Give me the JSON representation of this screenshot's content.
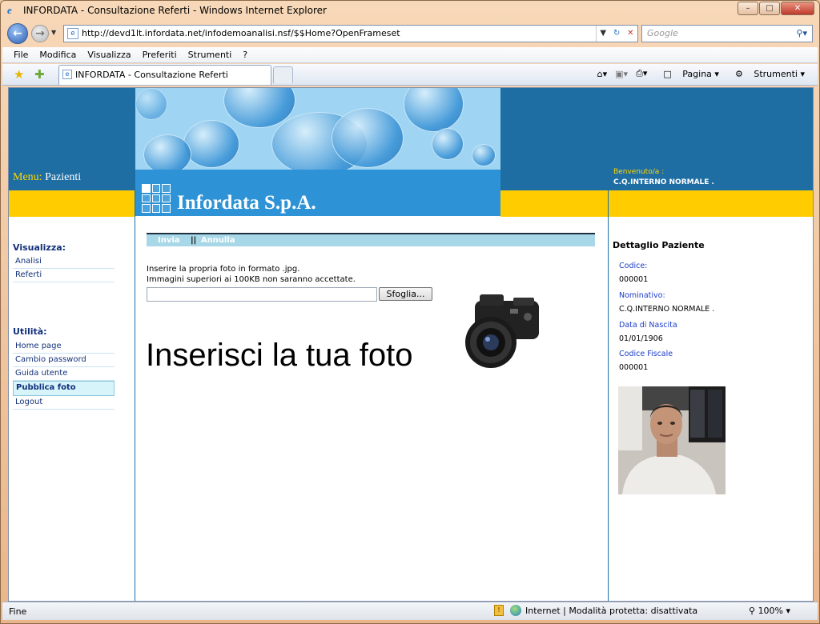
{
  "window": {
    "title": "INFORDATA - Consultazione Referti - Windows Internet Explorer"
  },
  "address": {
    "url": "http://devd1lt.infordata.net/infodemoanalisi.nsf/$$Home?OpenFrameset",
    "search_placeholder": "Google"
  },
  "menubar": [
    "File",
    "Modifica",
    "Visualizza",
    "Preferiti",
    "Strumenti",
    "?"
  ],
  "tab": {
    "label": "INFORDATA - Consultazione Referti"
  },
  "commandbar": {
    "page": "Pagina",
    "tools": "Strumenti"
  },
  "header": {
    "menu_label": "Menu:",
    "menu_value": "Pazienti",
    "logo": "Infordata S.p.A.",
    "welcome_label": "Benvenuto/a :",
    "welcome_user": "C.Q.INTERNO NORMALE ."
  },
  "sidebar": {
    "visualizza_title": "Visualizza:",
    "visualizza_items": [
      "Analisi",
      "Referti"
    ],
    "utilita_title": "Utilità:",
    "utilita_items": [
      "Home page",
      "Cambio password",
      "Guida utente",
      "Pubblica foto",
      "Logout"
    ]
  },
  "main": {
    "toolbar": {
      "send": "Invia",
      "sep": "||",
      "cancel": "Annulla"
    },
    "instruction_1": "Inserire la propria foto in formato .jpg.",
    "instruction_2": "Immagini superiori ai 100KB non saranno accettate.",
    "file_value": "",
    "browse_label": "Sfoglia...",
    "headline": "Inserisci la tua foto"
  },
  "patient": {
    "title": "Dettaglio Paziente",
    "codice_label": "Codice:",
    "codice": "000001",
    "nominativo_label": "Nominativo:",
    "nominativo": "C.Q.INTERNO NORMALE .",
    "nascita_label": "Data di Nascita",
    "nascita": "01/01/1906",
    "cf_label": "Codice Fiscale",
    "cf": "000001"
  },
  "status": {
    "left": "Fine",
    "zone": "Internet | Modalità protetta: disattivata",
    "zoom": "100%"
  },
  "colors": {
    "header_blue": "#1e6ea4",
    "band_yellow": "#ffcc00",
    "link_navy": "#12307a",
    "toolbar_cyan": "#a8d8e8"
  }
}
